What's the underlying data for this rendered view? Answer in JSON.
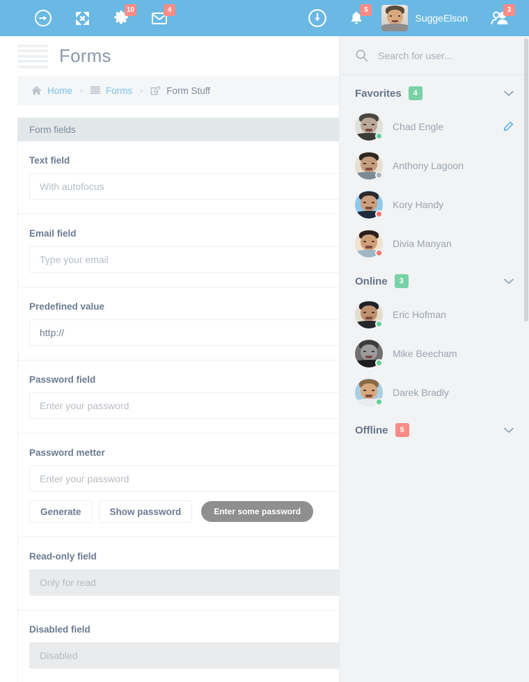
{
  "topbar": {
    "background": "#6ab8e4",
    "left_icons": [
      {
        "name": "circle-arrow-right-icon",
        "label": "Sign in",
        "badge": null
      },
      {
        "name": "expand-icon",
        "label": "Fullscreen",
        "badge": null
      },
      {
        "name": "gear-icon",
        "label": "Settings",
        "badge": "10"
      },
      {
        "name": "envelope-icon",
        "label": "Messages",
        "badge": "4"
      }
    ],
    "right_icons": [
      {
        "name": "circle-arrow-down-icon",
        "label": "Downloads",
        "badge": null
      },
      {
        "name": "bell-icon",
        "label": "Notifications",
        "badge": "5"
      }
    ],
    "user": {
      "name": "SuggeElson"
    },
    "users_icon": {
      "name": "users-icon",
      "label": "Users",
      "badge": "3"
    },
    "badge_color": "#f98b86"
  },
  "page": {
    "title": "Forms",
    "breadcrumb": [
      {
        "icon": "home-icon",
        "label": "Home",
        "link": true
      },
      {
        "icon": "list-icon",
        "label": "Forms",
        "link": true
      },
      {
        "icon": "edit-square-icon",
        "label": "Form Stuff",
        "link": false
      }
    ],
    "separator": "›"
  },
  "panel": {
    "header": "Form fields",
    "fields": [
      {
        "label": "Text field",
        "placeholder": "With autofocus",
        "value": "",
        "state": "normal"
      },
      {
        "label": "Email field",
        "placeholder": "Type your email",
        "value": "",
        "state": "normal"
      },
      {
        "label": "Predefined value",
        "placeholder": "",
        "value": "http://",
        "state": "normal"
      },
      {
        "label": "Password field",
        "placeholder": "Enter your password",
        "value": "",
        "state": "normal"
      },
      {
        "label": "Password metter",
        "placeholder": "Enter your password",
        "value": "",
        "state": "normal"
      },
      {
        "label": "Read-only field",
        "placeholder": "Only for read",
        "value": "",
        "state": "readonly"
      },
      {
        "label": "Disabled field",
        "placeholder": "Disabled",
        "value": "",
        "state": "disabled"
      }
    ],
    "password_buttons": {
      "generate": "Generate",
      "show": "Show password",
      "strength": "Enter some password",
      "strength_color": "#908f8f"
    }
  },
  "sidebar": {
    "search": {
      "placeholder": "Search for user...",
      "value": "",
      "icon": "search-icon"
    },
    "groups": [
      {
        "title": "Favorites",
        "count": "4",
        "count_color": "#79d2a6",
        "count_type": "green",
        "users": [
          {
            "name": "Chad Engle",
            "status": "online",
            "edit": true,
            "ava": {
              "bg": "#dfe0da",
              "hair": "#4a4640",
              "skin": "#b9a897",
              "body": "#3d3b38"
            }
          },
          {
            "name": "Anthony Lagoon",
            "status": "idle",
            "edit": false,
            "ava": {
              "bg": "#e6ded0",
              "hair": "#2c2722",
              "skin": "#c49c7e",
              "body": "#7b8a94"
            }
          },
          {
            "name": "Kory Handy",
            "status": "away",
            "edit": false,
            "ava": {
              "bg": "#8ec9ec",
              "hair": "#2a2a2e",
              "skin": "#cc9e7d",
              "body": "#1d2b3a"
            }
          },
          {
            "name": "Divia Manyan",
            "status": "away",
            "edit": false,
            "ava": {
              "bg": "#efe2cf",
              "hair": "#2a1f1a",
              "skin": "#cf9f78",
              "body": "#9fb7c6"
            }
          }
        ]
      },
      {
        "title": "Online",
        "count": "3",
        "count_color": "#79d2a6",
        "count_type": "green",
        "users": [
          {
            "name": "Eric Hofman",
            "status": "online",
            "edit": false,
            "ava": {
              "bg": "#e4ddcc",
              "hair": "#1f2228",
              "skin": "#c0916f",
              "body": "#24262b"
            }
          },
          {
            "name": "Mike Beecham",
            "status": "online",
            "edit": false,
            "ava": {
              "bg": "#6f6f6f",
              "hair": "#3b3b3b",
              "skin": "#9c9c9c",
              "body": "#1e1e1e"
            }
          },
          {
            "name": "Darek Bradly",
            "status": "online",
            "edit": false,
            "ava": {
              "bg": "#a9cfe4",
              "hair": "#8a6a45",
              "skin": "#d8a87f",
              "body": "#e9edf0"
            }
          }
        ]
      },
      {
        "title": "Offline",
        "count": "5",
        "count_color": "#f98b86",
        "count_type": "red",
        "users": []
      }
    ],
    "chevron": "chevron-down-icon"
  }
}
